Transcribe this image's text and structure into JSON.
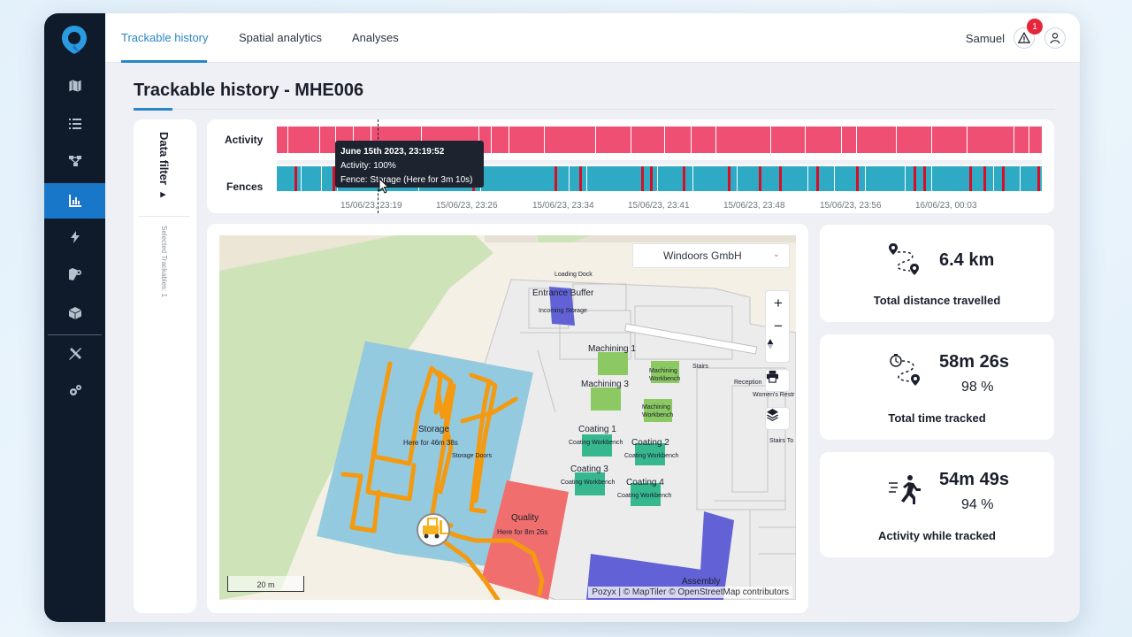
{
  "app": {
    "tabs": [
      {
        "label": "Trackable history",
        "active": true
      },
      {
        "label": "Spatial analytics",
        "active": false
      },
      {
        "label": "Analyses",
        "active": false
      }
    ],
    "user_name": "Samuel",
    "alert_count": "1",
    "accent_color": "#2a86c8",
    "sidebar_items": [
      "map-icon",
      "list-icon",
      "flow-icon",
      "chart-icon",
      "bolt-icon",
      "zone-settings-icon",
      "cube-icon",
      "tools-icon",
      "settings-icon"
    ],
    "active_sidebar_item": "chart-icon"
  },
  "page": {
    "title": "Trackable history - MHE006"
  },
  "filter": {
    "title": "Data filter ▸",
    "selected_text": "Selected Trackables:  1"
  },
  "timeline": {
    "activity_label": "Activity",
    "fences_label": "Fences",
    "activity_color": "#ef4f73",
    "fence_color": "#2eaac4",
    "alert_fence_color": "#d90e26",
    "ticks": [
      "15/06/23, 23:19",
      "15/06/23, 23:26",
      "15/06/23, 23:34",
      "15/06/23, 23:41",
      "15/06/23, 23:48",
      "15/06/23, 23:56",
      "16/06/23, 00:03"
    ],
    "tooltip": {
      "time": "June 15th 2023, 23:19:52",
      "activity": "Activity: 100%",
      "fence": "Fence: Storage (Here for 3m 10s)"
    }
  },
  "map": {
    "company": "Windoors GmbH",
    "scale": "20 m",
    "attribution": "Pozyx | © MapTiler © OpenStreetMap contributors",
    "labels": {
      "loading_dock": "Loading Dock",
      "entrance_buffer": "Entrance Buffer",
      "incoming_storage": "Incoming Storage",
      "machining1": "Machining 1",
      "machining3": "Machining 3",
      "machining_wb1": "Machining Workbench",
      "machining_wb2": "Machining Workbench",
      "stairs": "Stairs",
      "reception": "Reception",
      "womens_restroom": "Women's Restr",
      "stairs_to": "Stairs To",
      "storage": "Storage",
      "storage_time": "Here for 46m 38s",
      "storage_doors": "Storage Doors",
      "coating1": "Coating 1",
      "coating2": "Coating 2",
      "coating3": "Coating 3",
      "coating4": "Coating 4",
      "coating_wb1": "Coating Workbench",
      "coating_wb2": "Coating Workbench",
      "coating_wb3": "Coating Workbench",
      "coating_wb4": "Coating Workbench",
      "quality": "Quality",
      "quality_time": "Here for 8m 26s",
      "assembly": "Assembly"
    }
  },
  "stats": [
    {
      "value": "6.4 km",
      "label": "Total distance travelled",
      "icon": "route-icon"
    },
    {
      "value": "58m 26s",
      "percent": "98 %",
      "label": "Total time tracked",
      "icon": "timer-route-icon"
    },
    {
      "value": "54m 49s",
      "percent": "94 %",
      "label": "Activity while tracked",
      "icon": "running-icon"
    }
  ]
}
